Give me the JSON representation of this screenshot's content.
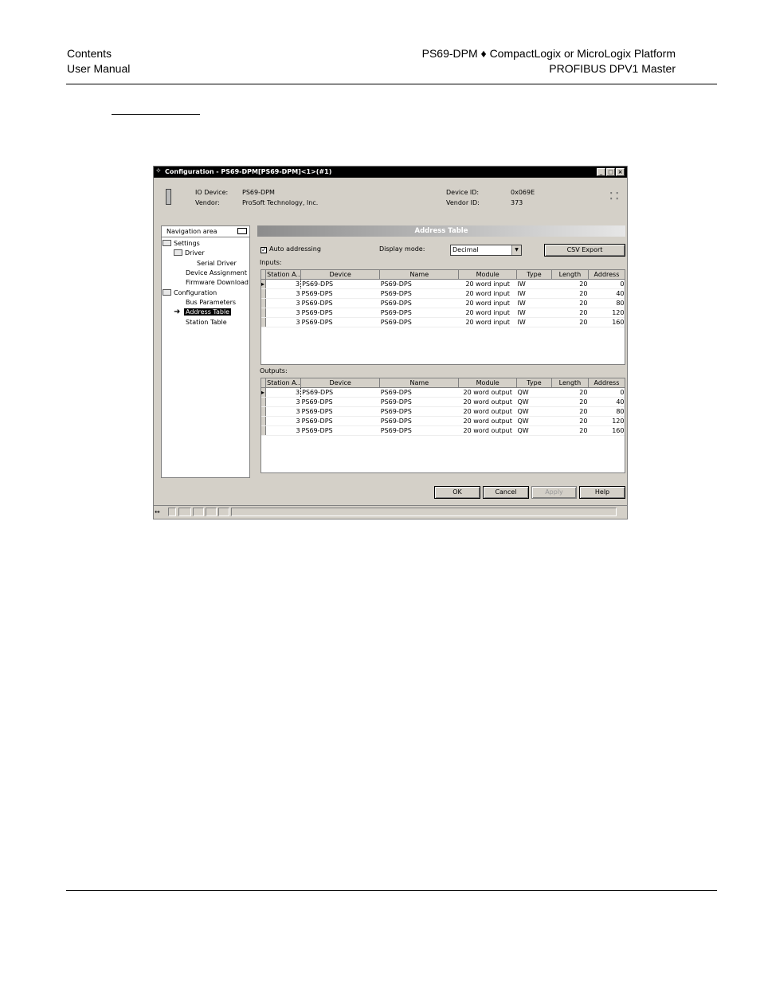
{
  "header": {
    "left_line1": "Contents",
    "left_line2": "User Manual",
    "right_line1": "PS69-DPM ♦ CompactLogix or MicroLogix Platform",
    "right_line2": "PROFIBUS DPV1 Master"
  },
  "window": {
    "title": "Configuration - PS69-DPM[PS69-DPM]<1>(#1)",
    "buttons": {
      "minimize": "_",
      "maximize": "□",
      "close": "×"
    },
    "info": {
      "io_device_label": "IO Device:",
      "io_device_value": "PS69-DPM",
      "vendor_label": "Vendor:",
      "vendor_value": "ProSoft Technology, Inc.",
      "device_id_label": "Device ID:",
      "device_id_value": "0x069E",
      "vendor_id_label": "Vendor ID:",
      "vendor_id_value": "373"
    },
    "nav": {
      "title": "Navigation area",
      "items": [
        "Settings",
        "Driver",
        "Serial Driver",
        "Device Assignment",
        "Firmware Download",
        "Configuration",
        "Bus Parameters",
        "Address Table",
        "Station Table"
      ],
      "selected": "Address Table"
    },
    "panel_title": "Address Table",
    "auto_addressing_label": "Auto addressing",
    "auto_addressing_checked": "✓",
    "display_mode_label": "Display mode:",
    "display_mode_value": "Decimal",
    "csv_export_label": "CSV Export",
    "inputs_label": "Inputs:",
    "outputs_label": "Outputs:",
    "columns": [
      "Station A...",
      "Device",
      "Name",
      "Module",
      "Type",
      "Length",
      "Address"
    ],
    "inputs": [
      [
        "3",
        "PS69-DPS",
        "PS69-DPS",
        "20 word input",
        "IW",
        "20",
        "0"
      ],
      [
        "3",
        "PS69-DPS",
        "PS69-DPS",
        "20 word input",
        "IW",
        "20",
        "40"
      ],
      [
        "3",
        "PS69-DPS",
        "PS69-DPS",
        "20 word input",
        "IW",
        "20",
        "80"
      ],
      [
        "3",
        "PS69-DPS",
        "PS69-DPS",
        "20 word input",
        "IW",
        "20",
        "120"
      ],
      [
        "3",
        "PS69-DPS",
        "PS69-DPS",
        "20 word input",
        "IW",
        "20",
        "160"
      ]
    ],
    "outputs": [
      [
        "3",
        "PS69-DPS",
        "PS69-DPS",
        "20 word output",
        "QW",
        "20",
        "0"
      ],
      [
        "3",
        "PS69-DPS",
        "PS69-DPS",
        "20 word output",
        "QW",
        "20",
        "40"
      ],
      [
        "3",
        "PS69-DPS",
        "PS69-DPS",
        "20 word output",
        "QW",
        "20",
        "80"
      ],
      [
        "3",
        "PS69-DPS",
        "PS69-DPS",
        "20 word output",
        "QW",
        "20",
        "120"
      ],
      [
        "3",
        "PS69-DPS",
        "PS69-DPS",
        "20 word output",
        "QW",
        "20",
        "160"
      ]
    ],
    "dialog_buttons": {
      "ok": "OK",
      "cancel": "Cancel",
      "apply": "Apply",
      "help": "Help"
    }
  }
}
